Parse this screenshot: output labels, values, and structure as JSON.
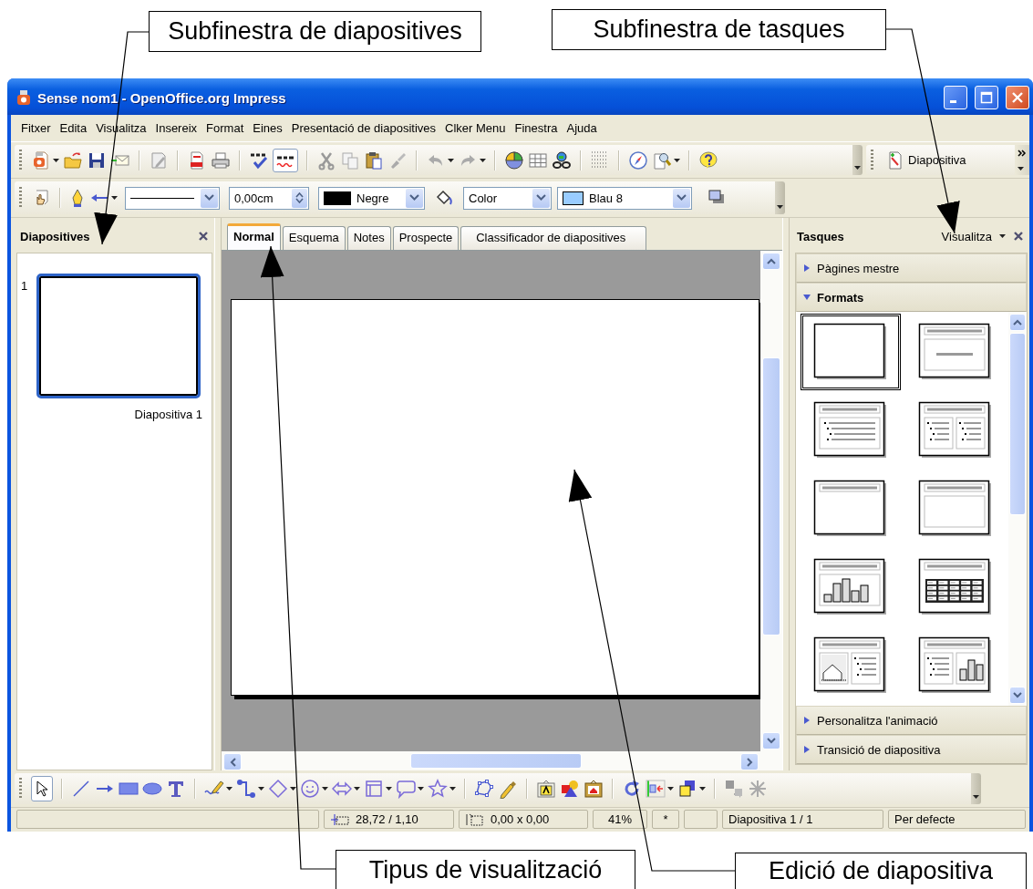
{
  "window": {
    "title": "Sense nom1 - OpenOffice.org Impress"
  },
  "menu": [
    {
      "label": "Fitxer"
    },
    {
      "label": "Edita"
    },
    {
      "label": "Visualitza"
    },
    {
      "label": "Insereix"
    },
    {
      "label": "Format"
    },
    {
      "label": "Eines"
    },
    {
      "label": "Presentació de diapositives"
    },
    {
      "label": "Clker Menu"
    },
    {
      "label": "Finestra"
    },
    {
      "label": "Ajuda"
    }
  ],
  "standard_toolbar": {
    "slide_button": "Diapositiva"
  },
  "line_toolbar": {
    "line_width": "0,00cm",
    "line_color": {
      "value": "Negre",
      "color": "#000000"
    },
    "area_style": "Color",
    "area_fill": {
      "value": "Blau 8",
      "color": "#99ccff"
    }
  },
  "slides_pane": {
    "title": "Diapositives",
    "slides": [
      {
        "number": "1",
        "name": "Diapositiva 1",
        "selected": true
      }
    ]
  },
  "view_tabs": [
    {
      "label": "Normal",
      "selected": true
    },
    {
      "label": "Esquema",
      "selected": false
    },
    {
      "label": "Notes",
      "selected": false
    },
    {
      "label": "Prospecte",
      "selected": false
    },
    {
      "label": "Classificador de diapositives",
      "selected": false
    }
  ],
  "tasks_pane": {
    "title": "Tasques",
    "view_menu": "Visualitza",
    "sections": [
      {
        "label": "Pàgines mestre",
        "expanded": false
      },
      {
        "label": "Formats",
        "expanded": true
      },
      {
        "label": "Personalitza l'animació",
        "expanded": false
      },
      {
        "label": "Transició de diapositiva",
        "expanded": false
      }
    ],
    "layouts": [
      {
        "kind": "blank",
        "selected": true
      },
      {
        "kind": "title",
        "selected": false
      },
      {
        "kind": "title-content",
        "selected": false
      },
      {
        "kind": "title-2content",
        "selected": false
      },
      {
        "kind": "title-only",
        "selected": false
      },
      {
        "kind": "centered",
        "selected": false
      },
      {
        "kind": "chart",
        "selected": false
      },
      {
        "kind": "table",
        "selected": false
      },
      {
        "kind": "clipart-content",
        "selected": false
      },
      {
        "kind": "content-chart",
        "selected": false
      }
    ]
  },
  "status_bar": {
    "position": "28,72 / 1,10",
    "size": "0,00 x 0,00",
    "zoom": "41%",
    "modified": "*",
    "slide": "Diapositiva 1 / 1",
    "layout": "Per defecte"
  },
  "callouts": [
    {
      "text": "Subfinestra de diapositives"
    },
    {
      "text": "Subfinestra de tasques"
    },
    {
      "text": "Tipus de visualització"
    },
    {
      "text": "Edició de diapositiva"
    }
  ]
}
